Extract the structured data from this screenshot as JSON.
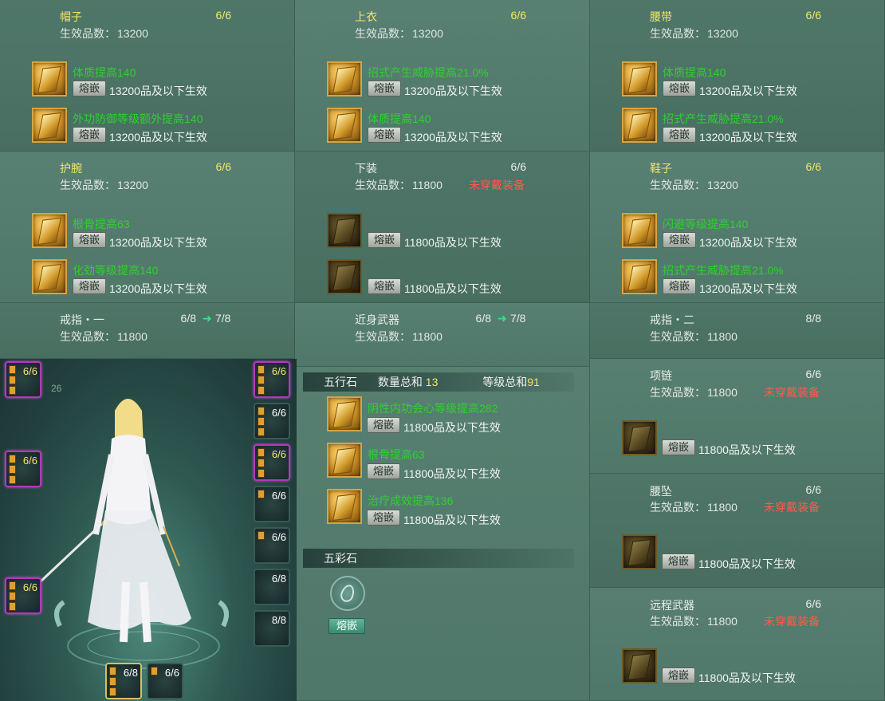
{
  "labels": {
    "effective_grade": "生效品数：",
    "inlay": "熔嵌",
    "not_worn": "未穿戴装备"
  },
  "equipment": [
    {
      "name": "帽子",
      "count": "6/6",
      "grade": "13200",
      "gems": [
        {
          "attr": "体质提高140",
          "req": "13200品及以下生效"
        },
        {
          "attr": "外功防御等级额外提高140",
          "req": "13200品及以下生效"
        }
      ]
    },
    {
      "name": "上衣",
      "count": "6/6",
      "grade": "13200",
      "gems": [
        {
          "attr": "招式产生威胁提高21.0%",
          "req": "13200品及以下生效"
        },
        {
          "attr": "体质提高140",
          "req": "13200品及以下生效"
        }
      ]
    },
    {
      "name": "腰带",
      "count": "6/6",
      "grade": "13200",
      "gems": [
        {
          "attr": "体质提高140",
          "req": "13200品及以下生效"
        },
        {
          "attr": "招式产生威胁提高21.0%",
          "req": "13200品及以下生效"
        }
      ]
    },
    {
      "name": "护腕",
      "count": "6/6",
      "grade": "13200",
      "gems": [
        {
          "attr": "根骨提高63",
          "req": "13200品及以下生效"
        },
        {
          "attr": "化劲等级提高140",
          "req": "13200品及以下生效"
        }
      ]
    },
    {
      "name": "下装",
      "count": "6/6",
      "grade": "11800",
      "warn": "未穿戴装备",
      "gems": [
        {
          "attr": "",
          "req": "11800品及以下生效"
        },
        {
          "attr": "",
          "req": "11800品及以下生效"
        }
      ]
    },
    {
      "name": "鞋子",
      "count": "6/6",
      "grade": "13200",
      "gems": [
        {
          "attr": "闪避等级提高140",
          "req": "13200品及以下生效"
        },
        {
          "attr": "招式产生威胁提高21.0%",
          "req": "13200品及以下生效"
        }
      ]
    },
    {
      "name": "戒指・一",
      "count": "6/8",
      "next": "7/8",
      "grade": "11800"
    },
    {
      "name": "近身武器",
      "count": "6/8",
      "next": "7/8",
      "grade": "11800"
    },
    {
      "name": "戒指・二",
      "count": "8/8",
      "grade": "11800"
    },
    {
      "name": "项链",
      "count": "6/6",
      "grade": "11800",
      "warn": "未穿戴装备",
      "gems": [
        {
          "attr": "",
          "req": "11800品及以下生效"
        }
      ]
    },
    {
      "name": "腰坠",
      "count": "6/6",
      "grade": "11800",
      "warn": "未穿戴装备",
      "gems": [
        {
          "attr": "",
          "req": "11800品及以下生效"
        }
      ]
    },
    {
      "name": "远程武器",
      "count": "6/6",
      "grade": "11800",
      "warn": "未穿戴装备",
      "gems": [
        {
          "attr": "",
          "req": "11800品及以下生效"
        }
      ]
    }
  ],
  "wuxing": {
    "title": "五行石",
    "qty_label": "数量总和",
    "qty": "13",
    "level_label": "等级总和",
    "level": "91",
    "gems": [
      {
        "attr": "阴性内功会心等级提高282",
        "req": "11800品及以下生效"
      },
      {
        "attr": "根骨提高63",
        "req": "11800品及以下生效"
      },
      {
        "attr": "治疗成效提高136",
        "req": "11800品及以下生效"
      }
    ]
  },
  "wucai": {
    "title": "五彩石",
    "button": "熔嵌"
  },
  "char_slots": {
    "left": [
      "6/6",
      "6/6",
      "6/6"
    ],
    "right": [
      "6/6",
      "6/6",
      "6/6",
      "6/6",
      "6/6",
      "6/8",
      "8/8"
    ],
    "bottom": [
      "6/8",
      "6/6"
    ],
    "faint_number": "26"
  },
  "colors": {
    "attr_green": "#2fd02f",
    "count_yellow": "#f3e66a",
    "warn_red": "#ff5a4c",
    "gem_gold": "#d6a540",
    "slot_purple": "#b03bb8"
  }
}
